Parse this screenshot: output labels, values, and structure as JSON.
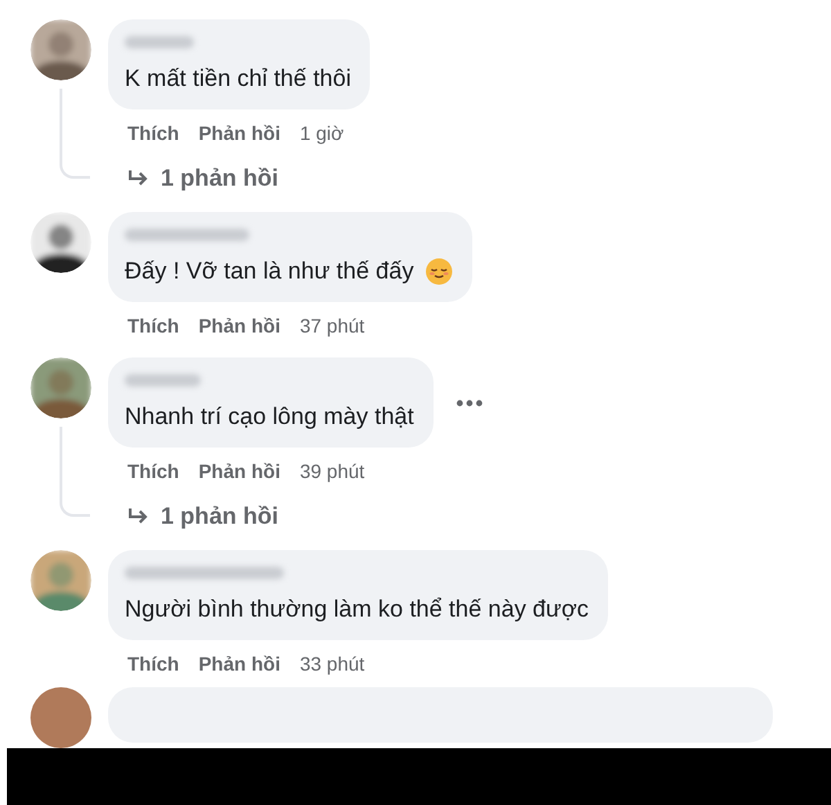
{
  "comments": [
    {
      "kind": "comment",
      "text": "K mất tiền chỉ thế thôi",
      "has_emoji": false,
      "show_more": false,
      "actions": {
        "like": "Thích",
        "reply": "Phản hồi",
        "time": "1 giờ"
      },
      "replies_link": "1 phản hồi"
    },
    {
      "kind": "comment",
      "text": "Đấy ! Vỡ tan là như thế đấy",
      "has_emoji": true,
      "show_more": false,
      "actions": {
        "like": "Thích",
        "reply": "Phản hồi",
        "time": "37 phút"
      }
    },
    {
      "kind": "comment",
      "text": "Nhanh trí cạo lông mày thật",
      "has_emoji": false,
      "show_more": true,
      "actions": {
        "like": "Thích",
        "reply": "Phản hồi",
        "time": "39 phút"
      },
      "replies_link": "1 phản hồi"
    },
    {
      "kind": "comment",
      "text": "Người bình thường làm ko thể thế này được",
      "has_emoji": false,
      "show_more": false,
      "actions": {
        "like": "Thích",
        "reply": "Phản hồi",
        "time": "33 phút"
      }
    },
    {
      "kind": "partial"
    }
  ]
}
